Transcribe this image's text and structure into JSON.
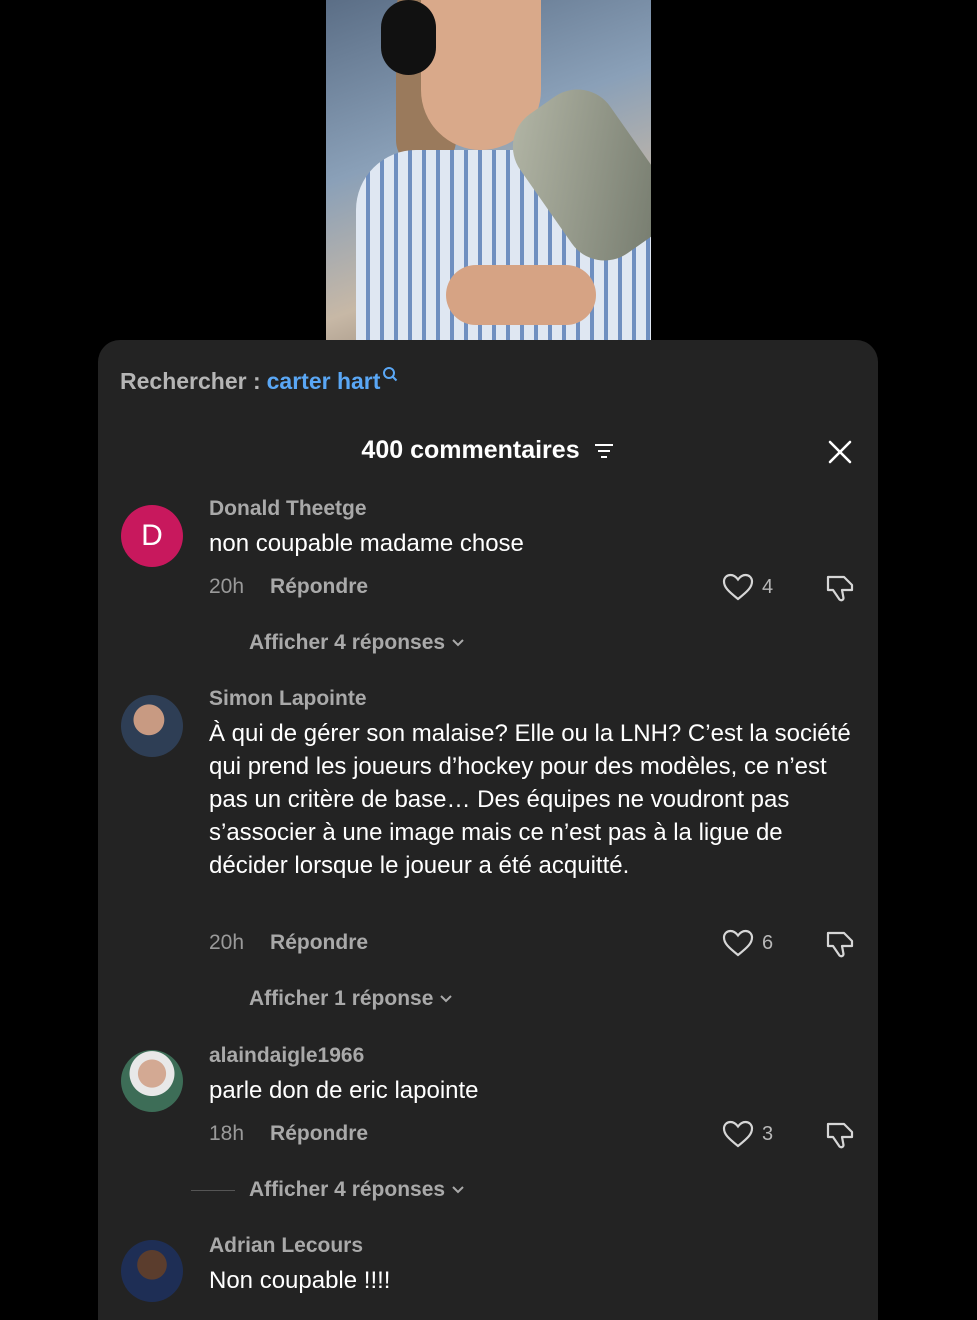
{
  "search": {
    "prefix": "Rechercher :",
    "query": "carter hart"
  },
  "header": {
    "title": "400 commentaires"
  },
  "comments": [
    {
      "author": "Donald Theetge",
      "avatar_letter": "D",
      "text": "non coupable madame chose",
      "time": "20h",
      "reply_label": "Répondre",
      "likes": "4",
      "show_replies": "Afficher 4 réponses"
    },
    {
      "author": "Simon Lapointe",
      "text": "À qui de gérer son malaise? Elle ou la LNH? C’est la société qui prend les joueurs d’hockey pour des modèles, ce n’est pas un critère de base… Des équipes ne voudront pas s’associer à une image mais ce n’est pas à la ligue de décider lorsque le joueur a été acquitté.",
      "time": "20h",
      "reply_label": "Répondre",
      "likes": "6",
      "show_replies": "Afficher 1 réponse"
    },
    {
      "author": "alaindaigle1966",
      "text": "parle don de eric lapointe",
      "time": "18h",
      "reply_label": "Répondre",
      "likes": "3",
      "show_replies": "Afficher 4 réponses"
    },
    {
      "author": "Adrian Lecours",
      "text": "Non coupable !!!!"
    }
  ],
  "colors": {
    "accent": "#5aa7f5",
    "sheet_bg": "#232323",
    "avatar_d": "#c8185d"
  }
}
